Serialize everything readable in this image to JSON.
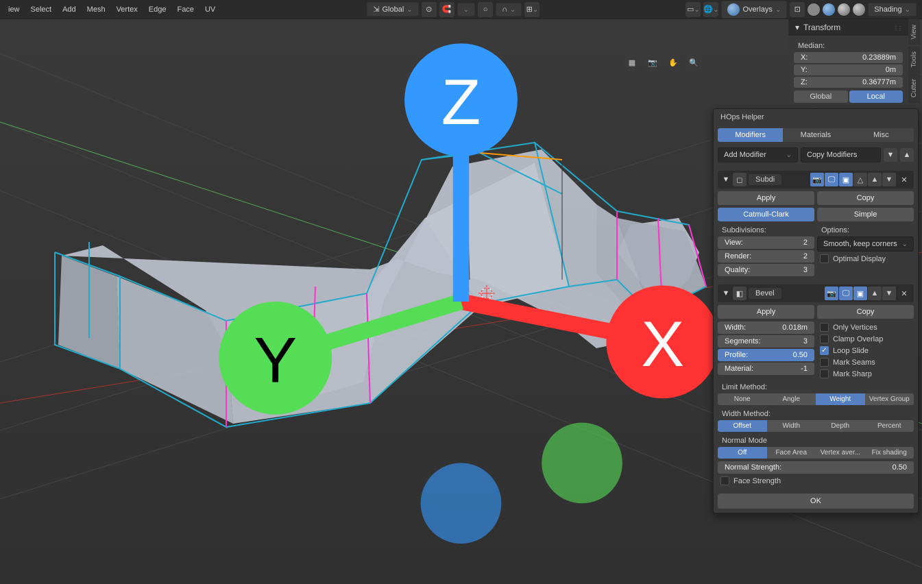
{
  "topMenu": [
    "iew",
    "Select",
    "Add",
    "Mesh",
    "Vertex",
    "Edge",
    "Face",
    "UV"
  ],
  "orientation": "Global",
  "overlays": "Overlays",
  "shading": "Shading",
  "sideTabs": [
    "View",
    "Tools",
    "Cutter"
  ],
  "transform": {
    "title": "Transform",
    "medianLabel": "Median:",
    "x": {
      "label": "X:",
      "value": "0.23889m"
    },
    "y": {
      "label": "Y:",
      "value": "0m"
    },
    "z": {
      "label": "Z:",
      "value": "0.36777m"
    },
    "global": "Global",
    "local": "Local"
  },
  "hops": {
    "title": "HOps Helper",
    "tabs": [
      "Modifiers",
      "Materials",
      "Misc"
    ],
    "addModifier": "Add Modifier",
    "copyModifiers": "Copy Modifiers",
    "apply": "Apply",
    "copy": "Copy",
    "ok": "OK"
  },
  "subdiv": {
    "name": "Subdi",
    "algo": [
      "Catmull-Clark",
      "Simple"
    ],
    "subdivisionsLabel": "Subdivisions:",
    "optionsLabel": "Options:",
    "view": {
      "label": "View:",
      "value": "2"
    },
    "render": {
      "label": "Render:",
      "value": "2"
    },
    "quality": {
      "label": "Quality:",
      "value": "3"
    },
    "uvSmooth": "Smooth, keep corners",
    "optimalDisplay": "Optimal Display"
  },
  "bevel": {
    "name": "Bevel",
    "width": {
      "label": "Width:",
      "value": "0.018m"
    },
    "segments": {
      "label": "Segments:",
      "value": "3"
    },
    "profile": {
      "label": "Profile:",
      "value": "0.50"
    },
    "material": {
      "label": "Material:",
      "value": "-1"
    },
    "onlyVertices": "Only Vertices",
    "clampOverlap": "Clamp Overlap",
    "loopSlide": "Loop Slide",
    "markSeams": "Mark Seams",
    "markSharp": "Mark Sharp",
    "limitMethodLabel": "Limit Method:",
    "limitMethods": [
      "None",
      "Angle",
      "Weight",
      "Vertex Group"
    ],
    "widthMethodLabel": "Width Method:",
    "widthMethods": [
      "Offset",
      "Width",
      "Depth",
      "Percent"
    ],
    "normalModeLabel": "Normal Mode",
    "normalModes": [
      "Off",
      "Face Area",
      "Vertex aver...",
      "Fix shading"
    ],
    "normalStrength": {
      "label": "Normal Strength:",
      "value": "0.50"
    },
    "faceStrength": "Face Strength"
  }
}
